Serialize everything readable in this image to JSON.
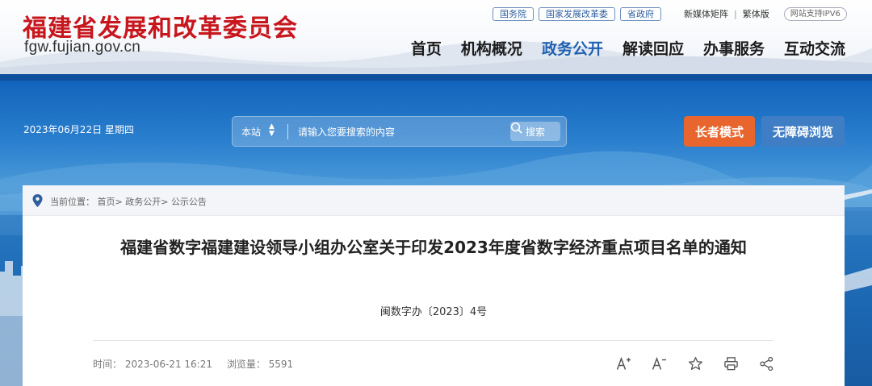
{
  "header": {
    "site_title": "福建省发展和改革委员会",
    "site_url": "fgw.fujian.gov.cn",
    "top_links": [
      "国务院",
      "国家发展改革委",
      "省政府"
    ],
    "matrix_link": "新媒体矩阵",
    "separator": "|",
    "traditional_link": "繁体版",
    "ipv6_badge": "网站支持IPV6",
    "nav": [
      "首页",
      "机构概况",
      "政务公开",
      "解读回应",
      "办事服务",
      "互动交流"
    ],
    "active_nav": "政务公开"
  },
  "banner": {
    "date": "2023年06月22日 星期四",
    "search_scope": "本站",
    "search_placeholder": "请输入您要搜索的内容",
    "search_button": "搜索",
    "elder_mode": "长者模式",
    "accessible_browse": "无障碍浏览"
  },
  "breadcrumb": {
    "prefix": "当前位置：",
    "items": [
      "首页",
      "政务公开",
      "公示公告"
    ],
    "sep": ">"
  },
  "article": {
    "title": "福建省数字福建建设领导小组办公室关于印发2023年度省数字经济重点项目名单的通知",
    "doc_number": "闽数字办〔2023〕4号",
    "time_label": "时间：",
    "time_value": "2023-06-21 16:21",
    "views_label": "浏览量：",
    "views_value": "5591"
  },
  "tools": [
    {
      "name": "font-increase-icon",
      "glyph": "A+"
    },
    {
      "name": "font-decrease-icon",
      "glyph": "A-"
    },
    {
      "name": "star-icon"
    },
    {
      "name": "print-icon"
    },
    {
      "name": "share-icon"
    }
  ],
  "colors": {
    "brand_red": "#c8161d",
    "nav_active": "#2060b2",
    "elder_button": "#e8662d",
    "access_button": "#3f7ec4"
  }
}
